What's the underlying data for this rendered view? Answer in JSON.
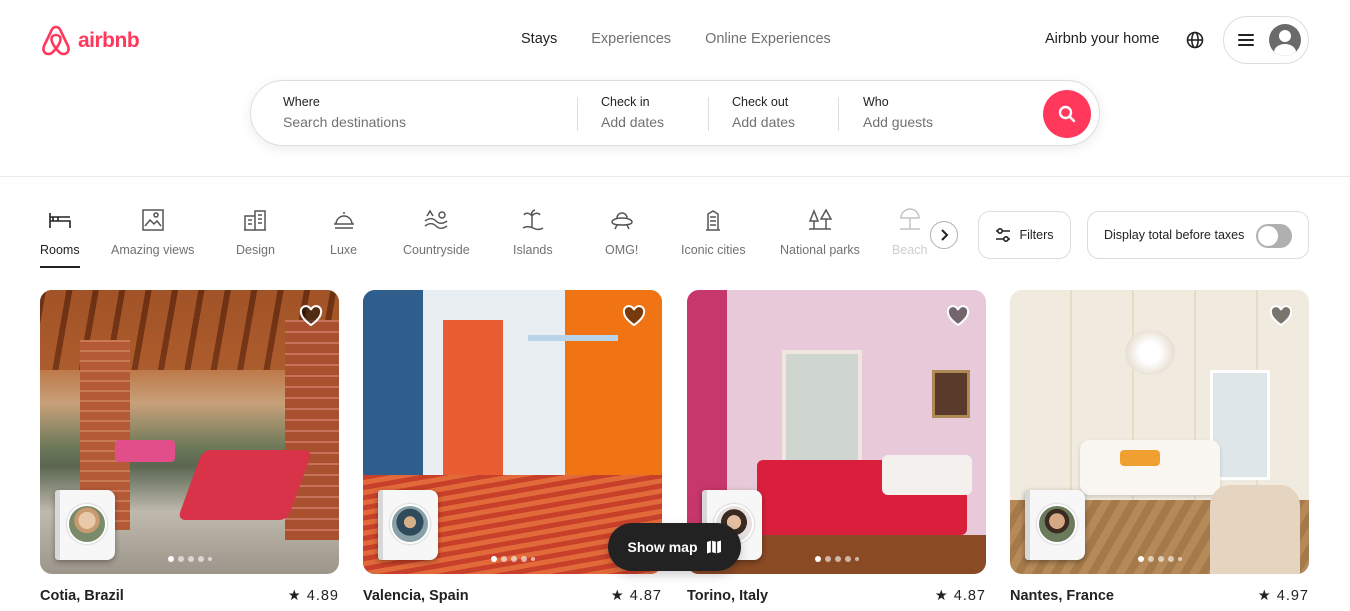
{
  "brand": {
    "name": "airbnb",
    "color": "#ff385c"
  },
  "nav": {
    "stays": "Stays",
    "experiences": "Experiences",
    "online": "Online Experiences"
  },
  "host_link": "Airbnb your home",
  "search": {
    "where_label": "Where",
    "where_placeholder": "Search destinations",
    "checkin_label": "Check in",
    "checkin_placeholder": "Add dates",
    "checkout_label": "Check out",
    "checkout_placeholder": "Add dates",
    "who_label": "Who",
    "who_placeholder": "Add guests"
  },
  "categories": [
    {
      "label": "Rooms",
      "icon": "bed-icon",
      "active": true
    },
    {
      "label": "Amazing views",
      "icon": "picture-icon"
    },
    {
      "label": "Design",
      "icon": "building-icon"
    },
    {
      "label": "Luxe",
      "icon": "cloche-icon"
    },
    {
      "label": "Countryside",
      "icon": "field-icon"
    },
    {
      "label": "Islands",
      "icon": "palm-island-icon"
    },
    {
      "label": "OMG!",
      "icon": "ufo-icon"
    },
    {
      "label": "Iconic cities",
      "icon": "tower-icon"
    },
    {
      "label": "National parks",
      "icon": "trees-icon"
    },
    {
      "label": "Beach",
      "icon": "beach-icon"
    }
  ],
  "filters_label": "Filters",
  "tax_toggle": {
    "label": "Display total before taxes",
    "on": false
  },
  "listings": [
    {
      "place": "Cotia, Brazil",
      "rating": "★ 4.89"
    },
    {
      "place": "Valencia, Spain",
      "rating": "★ 4.87"
    },
    {
      "place": "Torino, Italy",
      "rating": "★ 4.87"
    },
    {
      "place": "Nantes, France",
      "rating": "★ 4.97"
    }
  ],
  "show_map_label": "Show map"
}
